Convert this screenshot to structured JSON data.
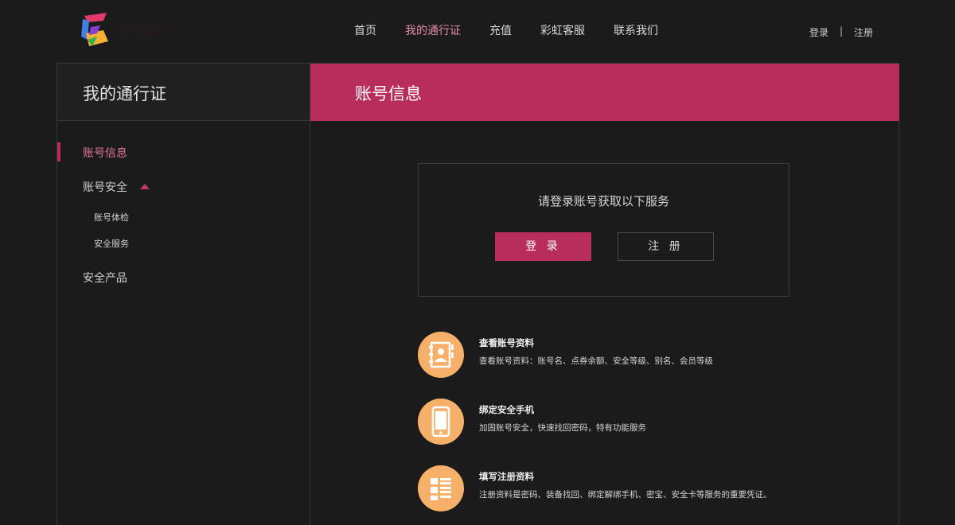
{
  "header": {
    "logo_text": "彩虹通行证",
    "nav": [
      {
        "label": "首页"
      },
      {
        "label": "我的通行证"
      },
      {
        "label": "充值"
      },
      {
        "label": "彩虹客服"
      },
      {
        "label": "联系我们"
      }
    ],
    "active_nav_index": 1,
    "login_link": "登录",
    "separator": "|",
    "register_link": "注册"
  },
  "sidebar": {
    "title": "我的通行证",
    "items": [
      {
        "label": "账号信息",
        "active": true
      },
      {
        "label": "账号安全",
        "expanded": true
      },
      {
        "label": "账号体检",
        "sub": true
      },
      {
        "label": "安全服务",
        "sub": true
      },
      {
        "label": "安全产品"
      }
    ]
  },
  "main": {
    "title": "账号信息",
    "login_box": {
      "prompt": "请登录账号获取以下服务",
      "login_button": "登 录",
      "register_button": "注 册"
    },
    "features": [
      {
        "icon": "contact-book-icon",
        "title": "查看账号资料",
        "desc": "查看账号资料：账号名、点券余额、安全等级、别名、会员等级"
      },
      {
        "icon": "mobile-phone-icon",
        "title": "绑定安全手机",
        "desc": "加固账号安全，快速找回密码，特有功能服务"
      },
      {
        "icon": "form-grid-icon",
        "title": "填写注册资料",
        "desc": "注册资料是密码、装备找回、绑定解绑手机、密宝、安全卡等服务的重要凭证。"
      }
    ]
  },
  "colors": {
    "accent": "#b82d5b",
    "active_text": "#e58aa8",
    "feature_icon_bg": "#f6b06a",
    "background": "#1b1b1b"
  }
}
